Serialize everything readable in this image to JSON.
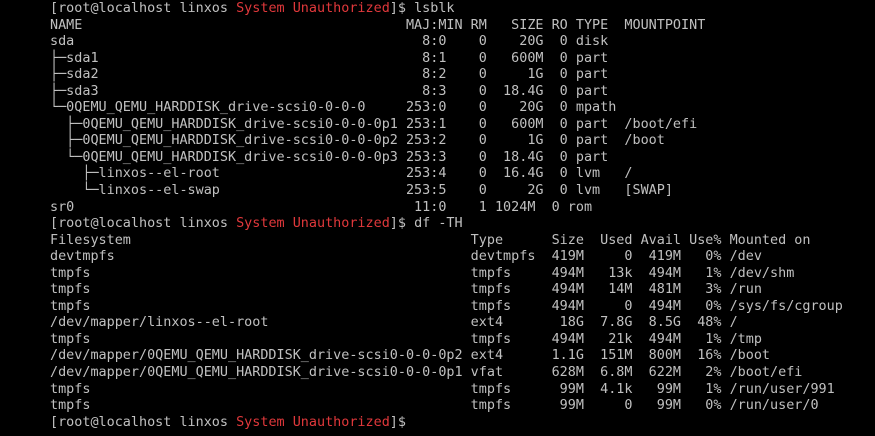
{
  "colors": {
    "background": "#000000",
    "text": "#c0c0c0",
    "highlight": "#e0383b"
  },
  "terminal": {
    "lines": [
      [
        {
          "t": "[root@localhost linxos "
        },
        {
          "t": "System Unauthorized",
          "c": "red"
        },
        {
          "t": "]$ lsblk"
        }
      ],
      [
        {
          "t": "NAME                                        MAJ:MIN RM   SIZE RO TYPE  MOUNTPOINT"
        }
      ],
      [
        {
          "t": "sda                                           8:0    0    20G  0 disk"
        }
      ],
      [
        {
          "t": "├─sda1                                        8:1    0   600M  0 part"
        }
      ],
      [
        {
          "t": "├─sda2                                        8:2    0     1G  0 part"
        }
      ],
      [
        {
          "t": "├─sda3                                        8:3    0  18.4G  0 part"
        }
      ],
      [
        {
          "t": "└─0QEMU_QEMU_HARDDISK_drive-scsi0-0-0-0     253:0    0    20G  0 mpath"
        }
      ],
      [
        {
          "t": "  ├─0QEMU_QEMU_HARDDISK_drive-scsi0-0-0-0p1 253:1    0   600M  0 part  /boot/efi"
        }
      ],
      [
        {
          "t": "  ├─0QEMU_QEMU_HARDDISK_drive-scsi0-0-0-0p2 253:2    0     1G  0 part  /boot"
        }
      ],
      [
        {
          "t": "  └─0QEMU_QEMU_HARDDISK_drive-scsi0-0-0-0p3 253:3    0  18.4G  0 part"
        }
      ],
      [
        {
          "t": "    ├─linxos--el-root                       253:4    0  16.4G  0 lvm   /"
        }
      ],
      [
        {
          "t": "    └─linxos--el-swap                       253:5    0     2G  0 lvm   [SWAP]"
        }
      ],
      [
        {
          "t": "sr0                                          11:0    1 1024M  0 rom"
        }
      ],
      [
        {
          "t": "[root@localhost linxos "
        },
        {
          "t": "System Unauthorized",
          "c": "red"
        },
        {
          "t": "]$ df -TH"
        }
      ],
      [
        {
          "t": "Filesystem                                          Type      Size  Used Avail Use% Mounted on"
        }
      ],
      [
        {
          "t": "devtmpfs                                            devtmpfs  419M     0  419M   0% /dev"
        }
      ],
      [
        {
          "t": "tmpfs                                               tmpfs     494M   13k  494M   1% /dev/shm"
        }
      ],
      [
        {
          "t": "tmpfs                                               tmpfs     494M   14M  481M   3% /run"
        }
      ],
      [
        {
          "t": "tmpfs                                               tmpfs     494M     0  494M   0% /sys/fs/cgroup"
        }
      ],
      [
        {
          "t": "/dev/mapper/linxos--el-root                         ext4       18G  7.8G  8.5G  48% /"
        }
      ],
      [
        {
          "t": "tmpfs                                               tmpfs     494M   21k  494M   1% /tmp"
        }
      ],
      [
        {
          "t": "/dev/mapper/0QEMU_QEMU_HARDDISK_drive-scsi0-0-0-0p2 ext4      1.1G  151M  800M  16% /boot"
        }
      ],
      [
        {
          "t": "/dev/mapper/0QEMU_QEMU_HARDDISK_drive-scsi0-0-0-0p1 vfat      628M  6.8M  622M   2% /boot/efi"
        }
      ],
      [
        {
          "t": "tmpfs                                               tmpfs      99M  4.1k   99M   1% /run/user/991"
        }
      ],
      [
        {
          "t": "tmpfs                                               tmpfs      99M     0   99M   0% /run/user/0"
        }
      ],
      [
        {
          "t": "[root@localhost linxos "
        },
        {
          "t": "System Unauthorized",
          "c": "red"
        },
        {
          "t": "]$ "
        }
      ]
    ]
  }
}
